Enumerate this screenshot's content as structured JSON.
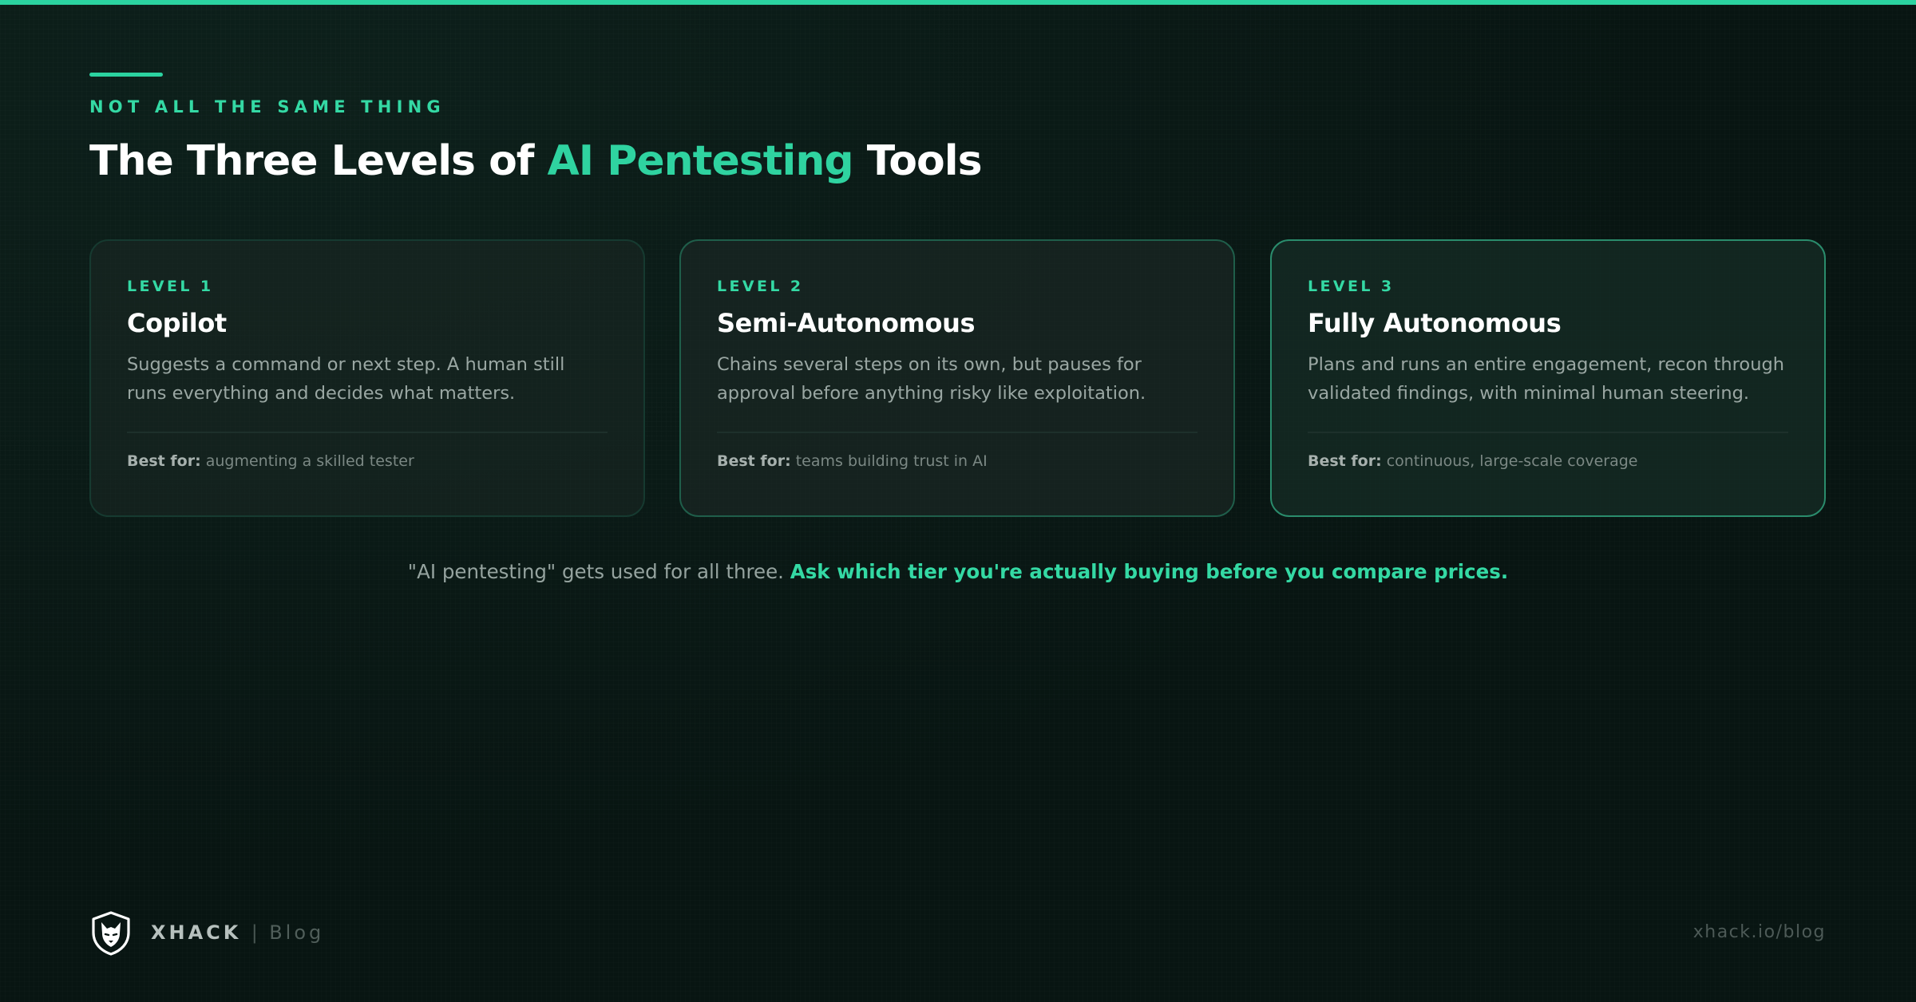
{
  "header": {
    "eyebrow": "NOT ALL THE SAME THING",
    "title_before": "The Three Levels of ",
    "title_highlight": "AI Pentesting",
    "title_after": " Tools"
  },
  "cards": [
    {
      "level": "LEVEL 1",
      "title": "Copilot",
      "description": "Suggests a command or next step. A human still runs everything and decides what matters.",
      "best_label": "Best for:",
      "best_value": "augmenting a skilled tester"
    },
    {
      "level": "LEVEL 2",
      "title": "Semi-Autonomous",
      "description": "Chains several steps on its own, but pauses for approval before anything risky like exploitation.",
      "best_label": "Best for:",
      "best_value": "teams building trust in AI"
    },
    {
      "level": "LEVEL 3",
      "title": "Fully Autonomous",
      "description": "Plans and runs an entire engagement, recon through validated findings, with minimal human steering.",
      "best_label": "Best for:",
      "best_value": "continuous, large-scale coverage"
    }
  ],
  "note": {
    "plain": "\"AI pentesting\" gets used for all three. ",
    "emphasis": "Ask which tier you're actually buying before you compare prices."
  },
  "footer": {
    "brand": "XHACK",
    "separator": "|",
    "section": "Blog",
    "url": "xhack.io/blog",
    "logo_icon": "wolf-shield-icon"
  },
  "colors": {
    "accent": "#2bd3a0",
    "background": "#081512",
    "card_border_level_1": "#163a30",
    "card_border_level_2": "#1f5e4a",
    "card_border_level_3": "#2a8c6c"
  }
}
